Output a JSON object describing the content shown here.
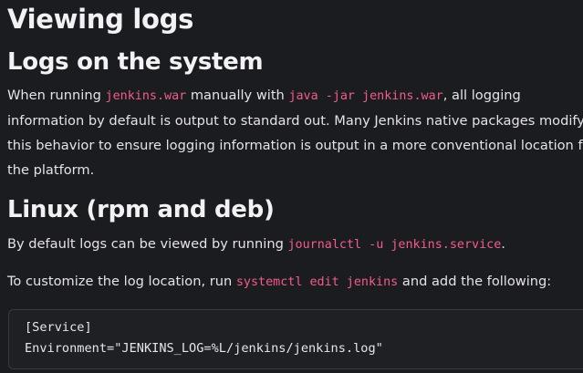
{
  "title": "Viewing logs",
  "sections": {
    "logs_on_system": {
      "heading": "Logs on the system",
      "para": {
        "t1": "When running ",
        "code1": "jenkins.war",
        "t2": " manually with ",
        "code2": "java -jar jenkins.war",
        "t3": ", all logging",
        "line2": "information by default is output to standard out. Many Jenkins native packages modify",
        "line3": "this behavior to ensure logging information is output in a more conventional location for",
        "line4": "the platform."
      }
    },
    "linux": {
      "heading": "Linux (rpm and deb)",
      "para1": {
        "t1": "By default logs can be viewed by running ",
        "code": "journalctl -u jenkins.service",
        "t2": "."
      },
      "para2": {
        "t1": "To customize the log location, run ",
        "code": "systemctl edit jenkins",
        "t2": " and add the following:"
      },
      "code_block": [
        "[Service]",
        "Environment=\"JENKINS_LOG=%L/jenkins/jenkins.log\""
      ]
    }
  },
  "colors": {
    "background": "#1b1c20",
    "text": "#e4e4e6",
    "inline_code": "#f25c8c",
    "code_block_bg": "#1f2024",
    "code_block_border": "#3a3b40"
  }
}
